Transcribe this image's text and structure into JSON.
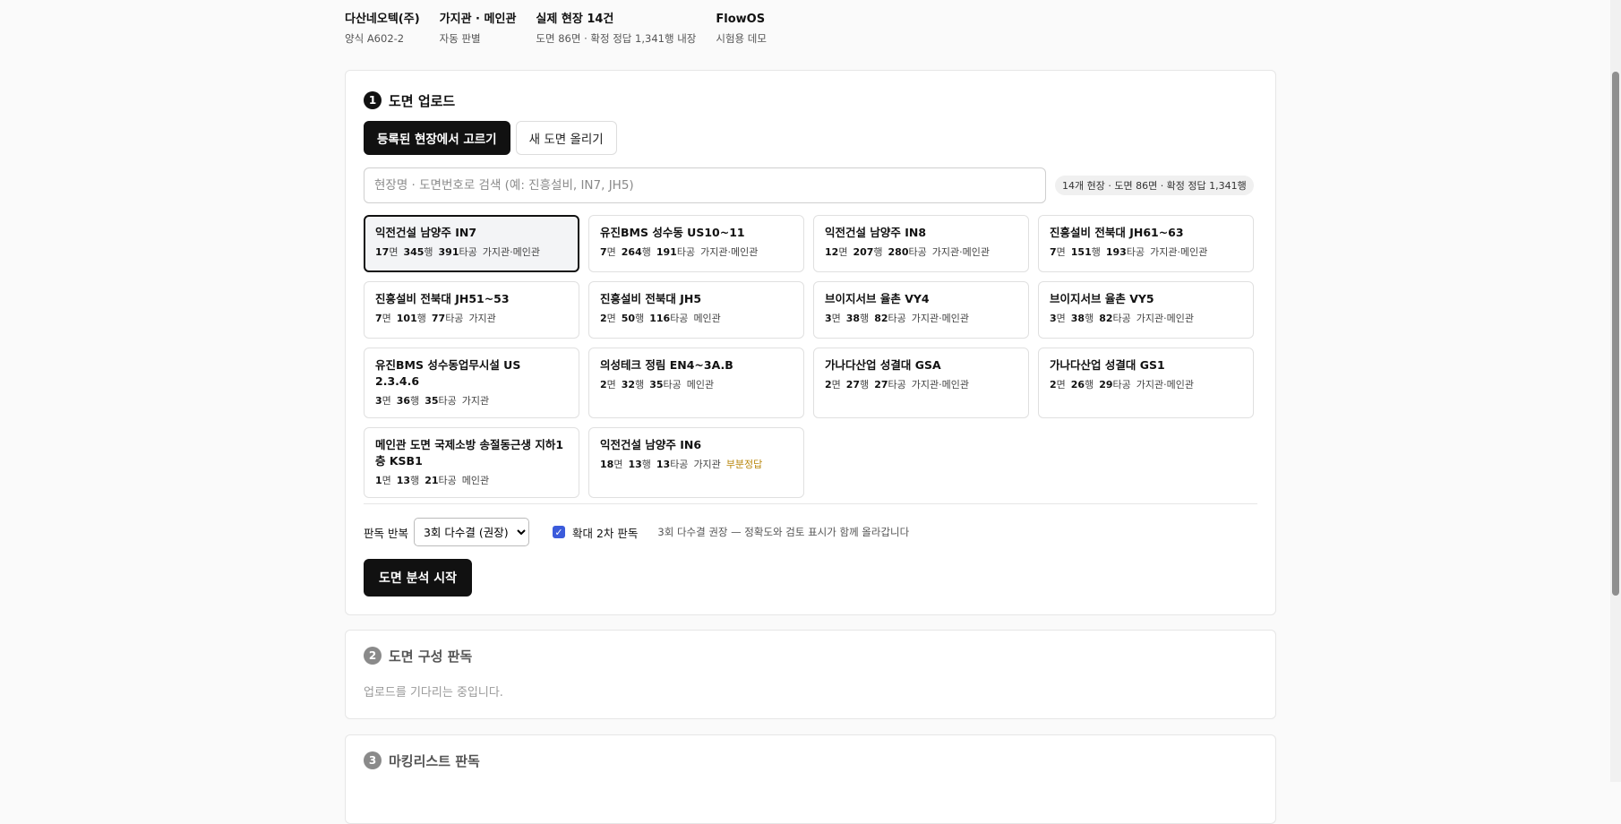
{
  "header": {
    "company": {
      "title": "다산네오텍(주)",
      "sub": "양식 A602-2"
    },
    "type": {
      "title": "가지관 · 메인관",
      "sub": "자동 판별"
    },
    "sites": {
      "title": "실제 현장 14건",
      "sub": "도면 86면 · 확정 정답 1,341행 내장"
    },
    "app": {
      "title": "FlowOS",
      "sub": "시험용 데모"
    }
  },
  "step1": {
    "num": "1",
    "title": "도면 업로드",
    "tabs": [
      "등록된 현장에서 고르기",
      "새 도면 올리기"
    ],
    "search_placeholder": "현장명 · 도면번호로 검색 (예: 진흥설비, IN7, JH5)",
    "search_value": "",
    "summary": "14개 현장 · 도면 86면 · 확정 정답 1,341행",
    "units": {
      "pages": "면",
      "rows": "행",
      "holes": "타공"
    },
    "sites": [
      {
        "name": "익전건설 남양주 IN7",
        "pages": "17",
        "rows": "345",
        "holes": "391",
        "kind": "가지관·메인관",
        "note": ""
      },
      {
        "name": "유진BMS 성수동 US10~11",
        "pages": "7",
        "rows": "264",
        "holes": "191",
        "kind": "가지관·메인관",
        "note": ""
      },
      {
        "name": "익전건설 남양주 IN8",
        "pages": "12",
        "rows": "207",
        "holes": "280",
        "kind": "가지관·메인관",
        "note": ""
      },
      {
        "name": "진흥설비 전북대 JH61~63",
        "pages": "7",
        "rows": "151",
        "holes": "193",
        "kind": "가지관·메인관",
        "note": ""
      },
      {
        "name": "진흥설비 전북대 JH51~53",
        "pages": "7",
        "rows": "101",
        "holes": "77",
        "kind": "가지관",
        "note": ""
      },
      {
        "name": "진흥설비 전북대 JH5",
        "pages": "2",
        "rows": "50",
        "holes": "116",
        "kind": "메인관",
        "note": ""
      },
      {
        "name": "브이지서브 율촌 VY4",
        "pages": "3",
        "rows": "38",
        "holes": "82",
        "kind": "가지관·메인관",
        "note": ""
      },
      {
        "name": "브이지서브 율촌 VY5",
        "pages": "3",
        "rows": "38",
        "holes": "82",
        "kind": "가지관·메인관",
        "note": ""
      },
      {
        "name": "유진BMS 성수동업무시설 US 2.3.4.6",
        "pages": "3",
        "rows": "36",
        "holes": "35",
        "kind": "가지관",
        "note": ""
      },
      {
        "name": "의성테크 정림 EN4~3A.B",
        "pages": "2",
        "rows": "32",
        "holes": "35",
        "kind": "메인관",
        "note": ""
      },
      {
        "name": "가나다산업 성결대 GSA",
        "pages": "2",
        "rows": "27",
        "holes": "27",
        "kind": "가지관·메인관",
        "note": ""
      },
      {
        "name": "가나다산업 성결대 GS1",
        "pages": "2",
        "rows": "26",
        "holes": "29",
        "kind": "가지관·메인관",
        "note": ""
      },
      {
        "name": "메인관 도면 국제소방 송절동근생 지하1층 KSB1",
        "pages": "1",
        "rows": "13",
        "holes": "21",
        "kind": "메인관",
        "note": ""
      },
      {
        "name": "익전건설 남양주 IN6",
        "pages": "18",
        "rows": "13",
        "holes": "13",
        "kind": "가지관",
        "note": "부분정답"
      }
    ],
    "repeat_label": "판독 반복",
    "repeat_selected": "3회 다수결 (권장)",
    "zoom_label": "확대 2차 판독",
    "zoom_checked": true,
    "hint": "3회 다수결 권장 — 정확도와 검토 표시가 함께 올라갑니다",
    "start_label": "도면 분석 시작"
  },
  "step2": {
    "num": "2",
    "title": "도면 구성 판독",
    "status": "업로드를 기다리는 중입니다."
  },
  "step3": {
    "num": "3",
    "title": "마킹리스트 판독"
  }
}
